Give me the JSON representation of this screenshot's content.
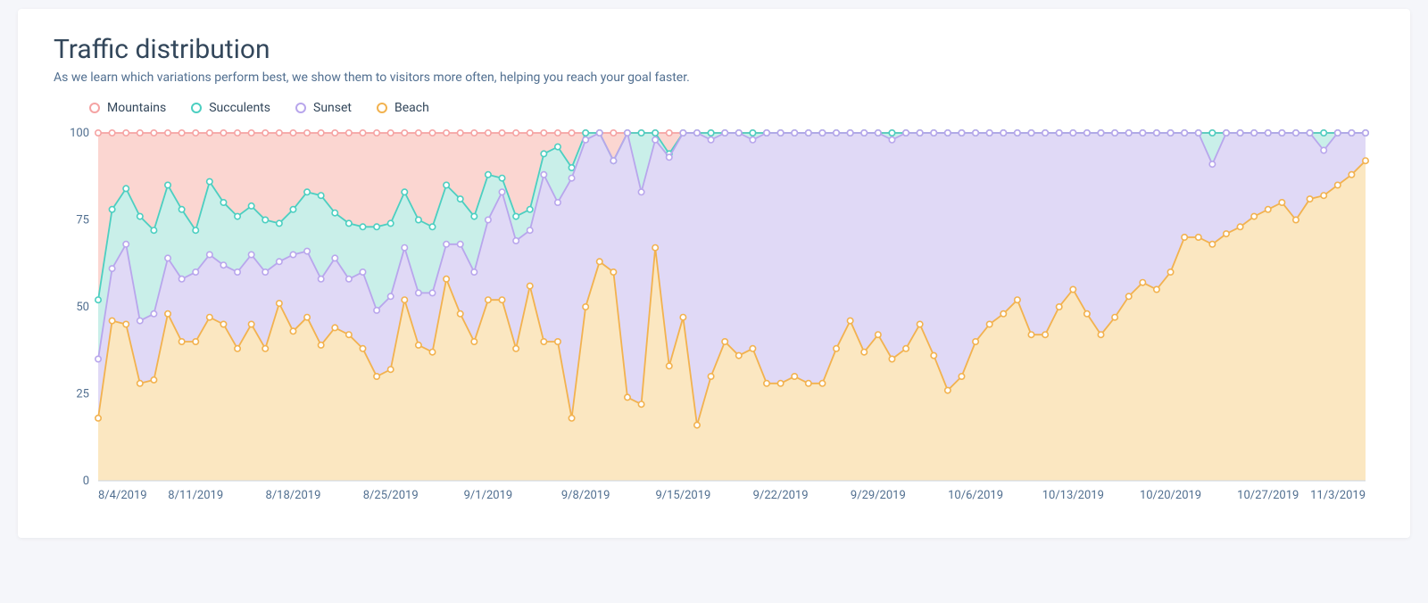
{
  "title": "Traffic distribution",
  "subtitle": "As we learn which variations perform best, we show them to visitors more often, helping you reach your goal faster.",
  "legend": {
    "mountains": "Mountains",
    "succulents": "Succulents",
    "sunset": "Sunset",
    "beach": "Beach"
  },
  "colors": {
    "mountains": "#f5a3a3",
    "succulents": "#4ccfc1",
    "sunset": "#b8a6ec",
    "beach": "#f2b24f",
    "mountains_fill": "#fbd6d1",
    "succulents_fill": "#c9efe9",
    "sunset_fill": "#e0d9f6",
    "beach_fill": "#fbe7c1"
  },
  "chart_data": {
    "type": "area",
    "ylim": [
      0,
      100
    ],
    "yticks": [
      0,
      25,
      50,
      75,
      100
    ],
    "xticks": [
      "8/4/2019",
      "8/11/2019",
      "8/18/2019",
      "8/25/2019",
      "9/1/2019",
      "9/8/2019",
      "9/15/2019",
      "9/22/2019",
      "9/29/2019",
      "10/6/2019",
      "10/13/2019",
      "10/20/2019",
      "10/27/2019",
      "11/3/2019"
    ],
    "categories_start": "8/4/2019",
    "categories_end": "11/3/2019",
    "n_points": 92,
    "series": [
      {
        "name": "Mountains",
        "values": [
          100,
          100,
          100,
          100,
          100,
          100,
          100,
          100,
          100,
          100,
          100,
          100,
          100,
          100,
          100,
          100,
          100,
          100,
          100,
          100,
          100,
          100,
          100,
          100,
          100,
          100,
          100,
          100,
          100,
          100,
          100,
          100,
          100,
          100,
          100,
          100,
          100,
          100,
          100,
          100,
          100,
          100,
          100,
          100,
          100,
          100,
          100,
          100,
          100,
          100,
          100,
          100,
          100,
          100,
          100,
          100,
          100,
          100,
          100,
          100,
          100,
          100,
          100,
          100,
          100,
          100,
          100,
          100,
          100,
          100,
          100,
          100,
          100,
          100,
          100,
          100,
          100,
          100,
          100,
          100,
          100,
          100,
          100,
          100,
          100,
          100,
          100,
          100,
          100,
          100,
          100,
          100
        ]
      },
      {
        "name": "Succulents",
        "values": [
          52,
          78,
          84,
          76,
          72,
          85,
          78,
          72,
          86,
          80,
          76,
          79,
          75,
          74,
          78,
          83,
          82,
          77,
          74,
          73,
          73,
          74,
          83,
          75,
          73,
          85,
          81,
          76,
          88,
          87,
          76,
          78,
          94,
          96,
          90,
          100,
          100,
          92,
          100,
          100,
          100,
          94,
          100,
          100,
          100,
          100,
          100,
          100,
          100,
          100,
          100,
          100,
          100,
          100,
          100,
          100,
          100,
          100,
          100,
          100,
          100,
          100,
          100,
          100,
          100,
          100,
          100,
          100,
          100,
          100,
          100,
          100,
          100,
          100,
          100,
          100,
          100,
          100,
          100,
          100,
          100,
          100,
          100,
          100,
          100,
          100,
          100,
          100,
          100,
          100,
          100,
          100
        ]
      },
      {
        "name": "Sunset",
        "values": [
          35,
          61,
          68,
          46,
          48,
          64,
          58,
          60,
          65,
          62,
          60,
          65,
          60,
          63,
          65,
          66,
          58,
          64,
          58,
          60,
          49,
          53,
          67,
          54,
          54,
          68,
          68,
          60,
          75,
          83,
          69,
          72,
          88,
          80,
          87,
          98,
          100,
          92,
          100,
          83,
          98,
          93,
          100,
          100,
          98,
          100,
          100,
          98,
          100,
          100,
          100,
          100,
          100,
          100,
          100,
          100,
          100,
          98,
          100,
          100,
          100,
          100,
          100,
          100,
          100,
          100,
          100,
          100,
          100,
          100,
          100,
          100,
          100,
          100,
          100,
          100,
          100,
          100,
          100,
          100,
          91,
          100,
          100,
          100,
          100,
          100,
          100,
          100,
          95,
          100,
          100,
          100
        ]
      },
      {
        "name": "Beach",
        "values": [
          18,
          46,
          45,
          28,
          29,
          48,
          40,
          40,
          47,
          45,
          38,
          45,
          38,
          51,
          43,
          47,
          39,
          44,
          42,
          38,
          30,
          32,
          52,
          39,
          37,
          58,
          48,
          40,
          52,
          52,
          38,
          56,
          40,
          40,
          18,
          50,
          63,
          60,
          24,
          22,
          67,
          33,
          47,
          16,
          30,
          40,
          36,
          38,
          28,
          28,
          30,
          28,
          28,
          38,
          46,
          37,
          42,
          35,
          38,
          45,
          36,
          26,
          30,
          40,
          45,
          48,
          52,
          42,
          42,
          50,
          55,
          48,
          42,
          47,
          53,
          57,
          55,
          60,
          70,
          70,
          68,
          71,
          73,
          76,
          78,
          80,
          75,
          81,
          82,
          85,
          88,
          92
        ]
      }
    ]
  }
}
